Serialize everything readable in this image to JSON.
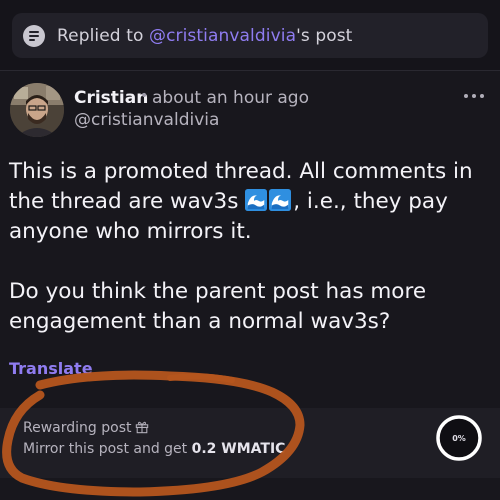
{
  "reply_banner": {
    "prefix": "Replied to ",
    "mention": "@cristianvaldivia",
    "suffix": "'s post",
    "icon": "document-icon"
  },
  "post": {
    "author_name": "Cristian",
    "separator": "•",
    "timestamp": "about an hour ago",
    "handle": "@cristianvaldivia",
    "more_icon": "more-horizontal-icon",
    "body": {
      "line1": "This is a promoted thread. All comments in",
      "line2_start": "the thread are wav3s ",
      "line2_end": ", i.e., they pay",
      "line3": "anyone who mirrors it.",
      "line4": "Do you think the parent post has more",
      "line5": "engagement than a normal wav3s?"
    },
    "emoji": "water-wave-emoji",
    "translate_label": "Translate"
  },
  "reward": {
    "title": "Rewarding post",
    "gift_icon": "gift-icon",
    "subtitle_prefix": "Mirror this post and get ",
    "amount": "0.2 WMATIC",
    "progress_label": "0%",
    "progress_value": 0
  },
  "colors": {
    "background": "#18171d",
    "accent": "#8f7cf0",
    "annotation": "#b5551e"
  }
}
